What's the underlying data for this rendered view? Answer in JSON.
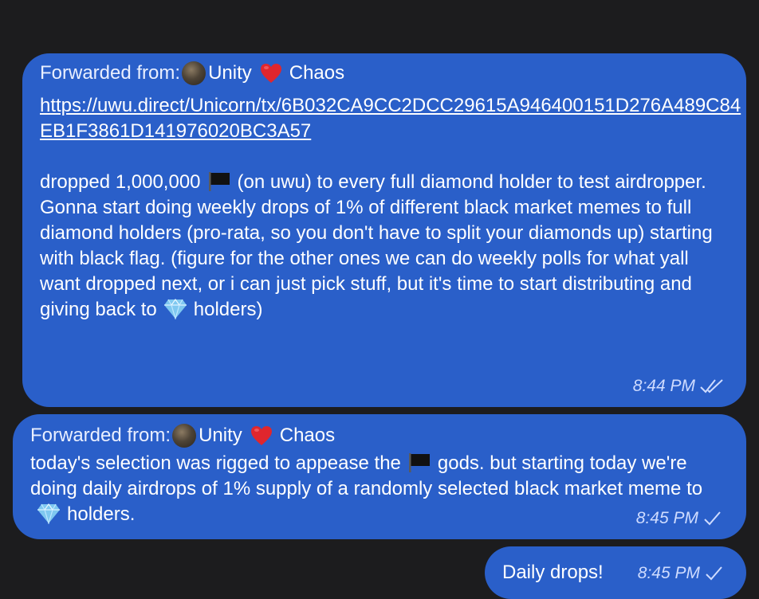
{
  "messages": [
    {
      "forward_label": "Forwarded from:",
      "channel_name_a": "Unity",
      "channel_name_b": "Chaos",
      "link": "https://uwu.direct/Unicorn/tx/6B032CA9CC2DCC29615A946400151D276A489C84EB1F3861D141976020BC3A57",
      "line1_a": "dropped 1,000,000",
      "line1_b": "(on uwu) to every full diamond holder to test airdropper.",
      "para2_a": "Gonna start doing weekly drops of 1% of different black market memes to full diamond holders (pro-rata, so you don't have to split your diamonds up) starting with black flag. (figure for the other ones we can do weekly polls for what yall want dropped next, or i can just pick stuff, but it's time to start distributing and giving back to",
      "para2_b": "holders)",
      "time": "8:44 PM",
      "status": "read"
    },
    {
      "forward_label": "Forwarded from:",
      "channel_name_a": "Unity",
      "channel_name_b": "Chaos",
      "text_a": "today's selection was rigged to appease the",
      "text_b": "gods. but starting today we're doing daily airdrops of 1% supply of a randomly selected black market meme to",
      "text_c": "holders.",
      "time": "8:45 PM",
      "status": "sent"
    },
    {
      "text": "Daily drops!",
      "time": "8:45 PM",
      "status": "sent"
    }
  ],
  "icons": {
    "avatar": "channel-avatar",
    "heart": "red-heart-emoji",
    "flag": "black-flag-emoji",
    "gem": "gem-stone-emoji",
    "read": "double-check-icon",
    "sent": "single-check-icon"
  },
  "colors": {
    "background": "#1c1c1e",
    "bubble": "#2a5fc9",
    "text": "#ffffff",
    "meta": "#cfdcff"
  }
}
